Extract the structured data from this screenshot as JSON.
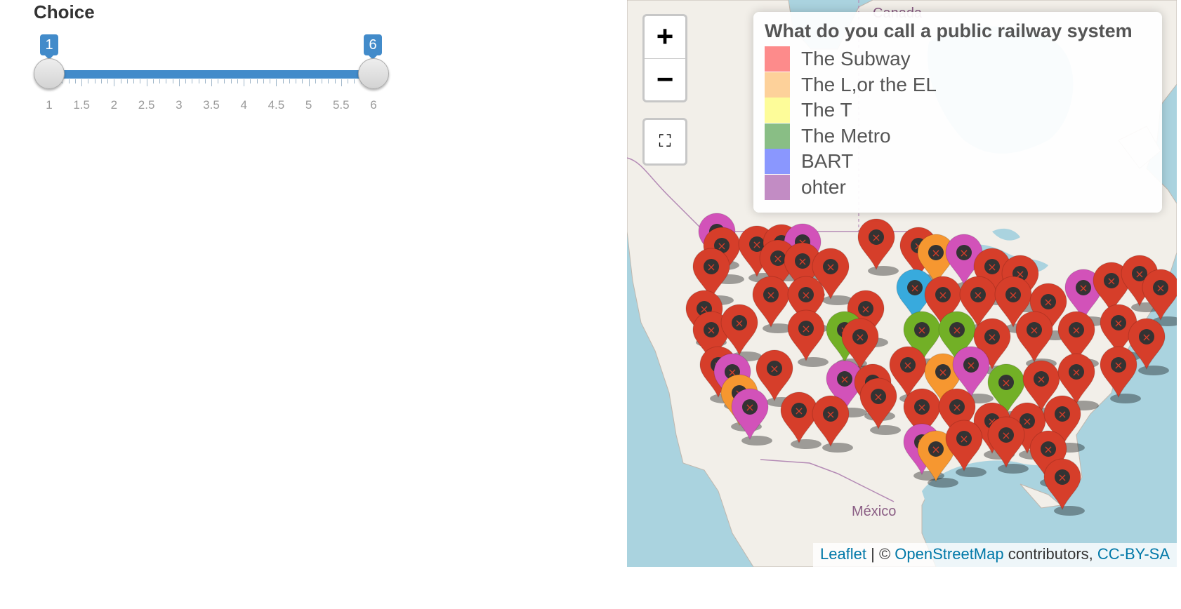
{
  "slider": {
    "label": "Choice",
    "min_value": "1",
    "max_value": "6",
    "ticks": [
      "1",
      "1.5",
      "2",
      "2.5",
      "3",
      "3.5",
      "4",
      "4.5",
      "5",
      "5.5",
      "6"
    ],
    "accent_color": "#428bca"
  },
  "map": {
    "controls": {
      "zoom_in": "+",
      "zoom_out": "−",
      "fullscreen_icon": "fullscreen-icon"
    },
    "legend": {
      "title": "What do you call a public railway system",
      "items": [
        {
          "label": "The Subway",
          "color": "#fd8b8b"
        },
        {
          "label": "The L,or the EL",
          "color": "#fdd19a"
        },
        {
          "label": "The T",
          "color": "#fdfc99"
        },
        {
          "label": "The Metro",
          "color": "#89be85"
        },
        {
          "label": "BART",
          "color": "#8a97fe"
        },
        {
          "label": "ohter",
          "color": "#c28cc4"
        }
      ]
    },
    "place_labels": {
      "canada": "Canada",
      "mexico": "México"
    },
    "attribution": {
      "leaflet": "Leaflet",
      "sep": " | © ",
      "osm": "OpenStreetMap",
      "contributors": " contributors, ",
      "license": "CC-BY-SA"
    },
    "marker_colors": {
      "default": "#d63e2a",
      "purple": "#d252b9",
      "orange": "#f69730",
      "green": "#72b026",
      "blue": "#38aadd"
    }
  }
}
